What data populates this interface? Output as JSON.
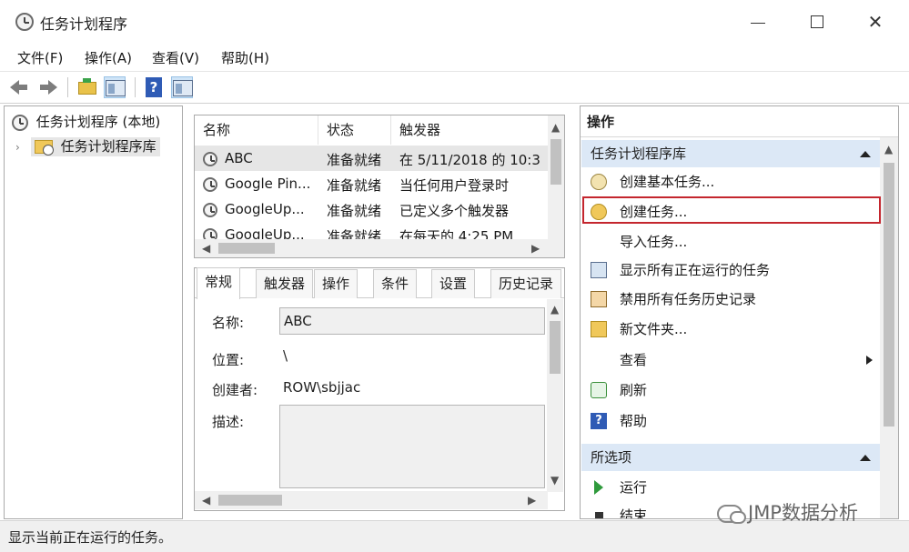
{
  "window": {
    "title": "任务计划程序"
  },
  "menu": [
    "文件(F)",
    "操作(A)",
    "查看(V)",
    "帮助(H)"
  ],
  "tree": {
    "root": "任务计划程序 (本地)",
    "child": "任务计划程序库"
  },
  "tasklist": {
    "columns": [
      "名称",
      "状态",
      "触发器"
    ],
    "rows": [
      {
        "name": "ABC",
        "status": "准备就绪",
        "trigger": "在 5/11/2018 的 10:3"
      },
      {
        "name": "Google Pin...",
        "status": "准备就绪",
        "trigger": "当任何用户登录时"
      },
      {
        "name": "GoogleUp...",
        "status": "准备就绪",
        "trigger": "已定义多个触发器"
      },
      {
        "name": "GoogleUp...",
        "status": "准备就绪",
        "trigger": "在每天的 4:25 PM"
      }
    ]
  },
  "detail": {
    "tabs": [
      "常规",
      "触发器",
      "操作",
      "条件",
      "设置",
      "历史记录"
    ],
    "name_label": "名称:",
    "name_value": "ABC",
    "location_label": "位置:",
    "location_value": "\\",
    "author_label": "创建者:",
    "author_value": "ROW\\sbjjac",
    "desc_label": "描述:"
  },
  "actions": {
    "header": "操作",
    "section1": "任务计划程序库",
    "items": [
      {
        "label": "创建基本任务...",
        "icon": "wizard-icon"
      },
      {
        "label": "创建任务...",
        "icon": "task-icon"
      },
      {
        "label": "导入任务...",
        "icon": ""
      },
      {
        "label": "显示所有正在运行的任务",
        "icon": "running-tasks-icon"
      },
      {
        "label": "禁用所有任务历史记录",
        "icon": "history-icon"
      },
      {
        "label": "新文件夹...",
        "icon": "new-folder-icon"
      },
      {
        "label": "查看",
        "icon": ""
      },
      {
        "label": "刷新",
        "icon": "refresh-icon"
      },
      {
        "label": "帮助",
        "icon": "help-icon"
      }
    ],
    "section2": "所选项",
    "items2": [
      {
        "label": "运行",
        "icon": "run-icon"
      },
      {
        "label": "结束",
        "icon": "end-icon"
      }
    ]
  },
  "status": {
    "text": "显示当前正在运行的任务。"
  },
  "watermark": {
    "text": "JMP数据分析"
  },
  "colors": {
    "accent_section": "#dce8f6",
    "highlight_border": "#c4262e",
    "selection": "#e6e6e6"
  }
}
